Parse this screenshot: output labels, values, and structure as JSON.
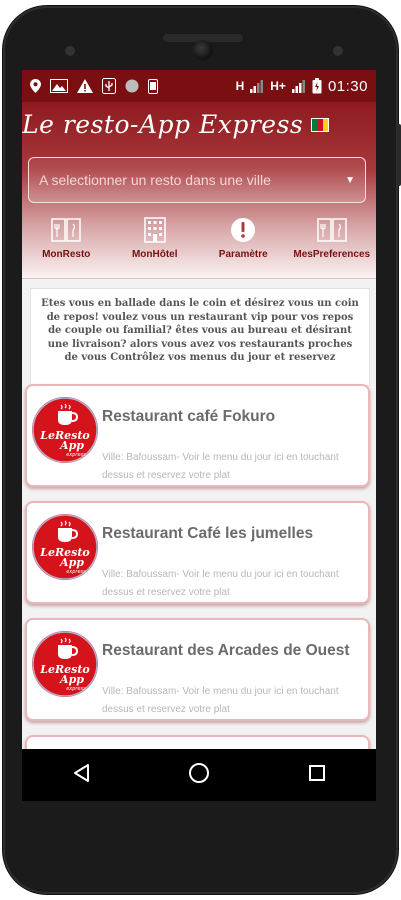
{
  "status_bar": {
    "network_1": "H",
    "network_2": "H+",
    "time": "01:30"
  },
  "app": {
    "title": "Le resto-App Express",
    "spinner_placeholder": "A selectionner un resto dans une ville",
    "brand_color": "#7a0f12"
  },
  "tabs": [
    {
      "label": "MonResto",
      "icon": "menu-book-icon"
    },
    {
      "label": "MonHôtel",
      "icon": "building-icon"
    },
    {
      "label": "Paramètre",
      "icon": "alert-icon"
    },
    {
      "label": "MesPreferences",
      "icon": "menu-book-icon"
    }
  ],
  "intro_text": "Etes vous en ballade dans le coin et désirez vous un coin de repos! voulez vous un restaurant vip pour vos repos de couple ou familial? êtes vous au bureau et désirant une livraison? alors vous avez vos restaurants proches de vous Contrôlez vos menus du jour et reservez",
  "logo": {
    "line1": "LeResto",
    "line2": "App",
    "line3": "express"
  },
  "restaurants": [
    {
      "name": "Restaurant café Fokuro",
      "description": "Ville: Bafoussam- Voir le menu du jour ici en touchant dessus et reservez votre plat"
    },
    {
      "name": "Restaurant Café les jumelles",
      "description": "Ville: Bafoussam- Voir le menu du jour ici en touchant dessus et reservez votre plat"
    },
    {
      "name": "Restaurant des Arcades de Ouest",
      "description": "Ville: Bafoussam- Voir le menu du jour ici en touchant dessus et reservez votre plat"
    }
  ],
  "nav": {
    "back": "back-icon",
    "home": "home-icon",
    "recents": "recents-icon"
  }
}
